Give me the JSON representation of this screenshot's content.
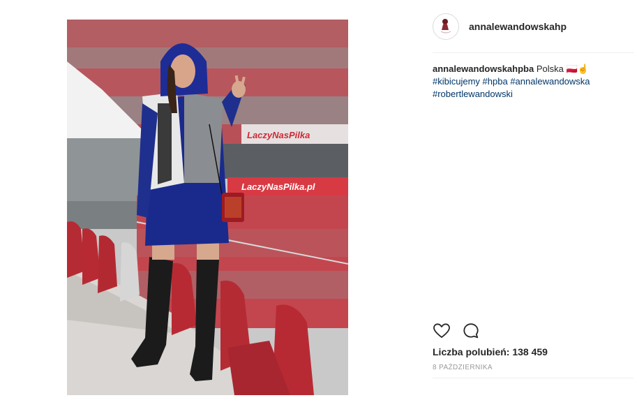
{
  "post": {
    "username": "annalewandowskahp",
    "avatar_icon": "avatar-logo-icon",
    "caption": {
      "user": "annalewandowskahpba",
      "text": " Polska ",
      "emoji": "🇵🇱☝",
      "tags": [
        "#kibicujemy",
        "#hpba",
        "#annalewandowska",
        "#robertlewandowski"
      ]
    },
    "actions": {
      "like_icon": "heart-icon",
      "comment_icon": "comment-icon"
    },
    "likes_text": "Liczba polubień: 138 459",
    "date_text": "8 PAŹDZIERNIKA"
  },
  "photo": {
    "banner_text_1": "LaczyNasPilka",
    "banner_text_2": "LaczyNasPilka.pl",
    "colors": {
      "stand_red": "#c8333d",
      "seat_red": "#b82a33",
      "hoodie_blue": "#1a2a8c",
      "boots": "#1b1b1b"
    }
  }
}
